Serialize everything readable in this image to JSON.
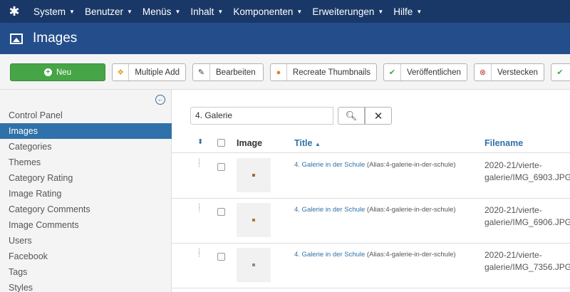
{
  "topbar": {
    "menu": [
      {
        "label": "System"
      },
      {
        "label": "Benutzer"
      },
      {
        "label": "Menüs"
      },
      {
        "label": "Inhalt"
      },
      {
        "label": "Komponenten"
      },
      {
        "label": "Erweiterungen"
      },
      {
        "label": "Hilfe"
      }
    ]
  },
  "header": {
    "title": "Images"
  },
  "toolbar": {
    "new_label": "Neu",
    "multiple_add_label": "Multiple Add",
    "edit_label": "Bearbeiten",
    "recreate_label": "Recreate Thumbnails",
    "publish_label": "Veröffentlichen",
    "hide_label": "Verstecken"
  },
  "sidebar": {
    "items": [
      {
        "label": "Control Panel"
      },
      {
        "label": "Images"
      },
      {
        "label": "Categories"
      },
      {
        "label": "Themes"
      },
      {
        "label": "Category Rating"
      },
      {
        "label": "Image Rating"
      },
      {
        "label": "Category Comments"
      },
      {
        "label": "Image Comments"
      },
      {
        "label": "Users"
      },
      {
        "label": "Facebook"
      },
      {
        "label": "Tags"
      },
      {
        "label": "Styles"
      }
    ]
  },
  "search": {
    "value": "4. Galerie"
  },
  "table": {
    "columns": {
      "image": "Image",
      "title": "Title",
      "filename": "Filename"
    },
    "rows": [
      {
        "title": "4. Galerie in der Schule",
        "alias": "(Alias:4-galerie-in-der-schule)",
        "file_line1": "2020-21/vierte-",
        "file_line2": "galerie/IMG_6903.JPG"
      },
      {
        "title": "4. Galerie in der Schule",
        "alias": "(Alias:4-galerie-in-der-schule)",
        "file_line1": "2020-21/vierte-",
        "file_line2": "galerie/IMG_6906.JPG"
      },
      {
        "title": "4. Galerie in der Schule",
        "alias": "(Alias:4-galerie-in-der-schule)",
        "file_line1": "2020-21/vierte-",
        "file_line2": "galerie/IMG_7356.JPG"
      }
    ]
  },
  "colors": {
    "topbar": "#1a3867",
    "titlebar": "#244e8b",
    "accent": "#3071a9",
    "new_button": "#46a546"
  }
}
